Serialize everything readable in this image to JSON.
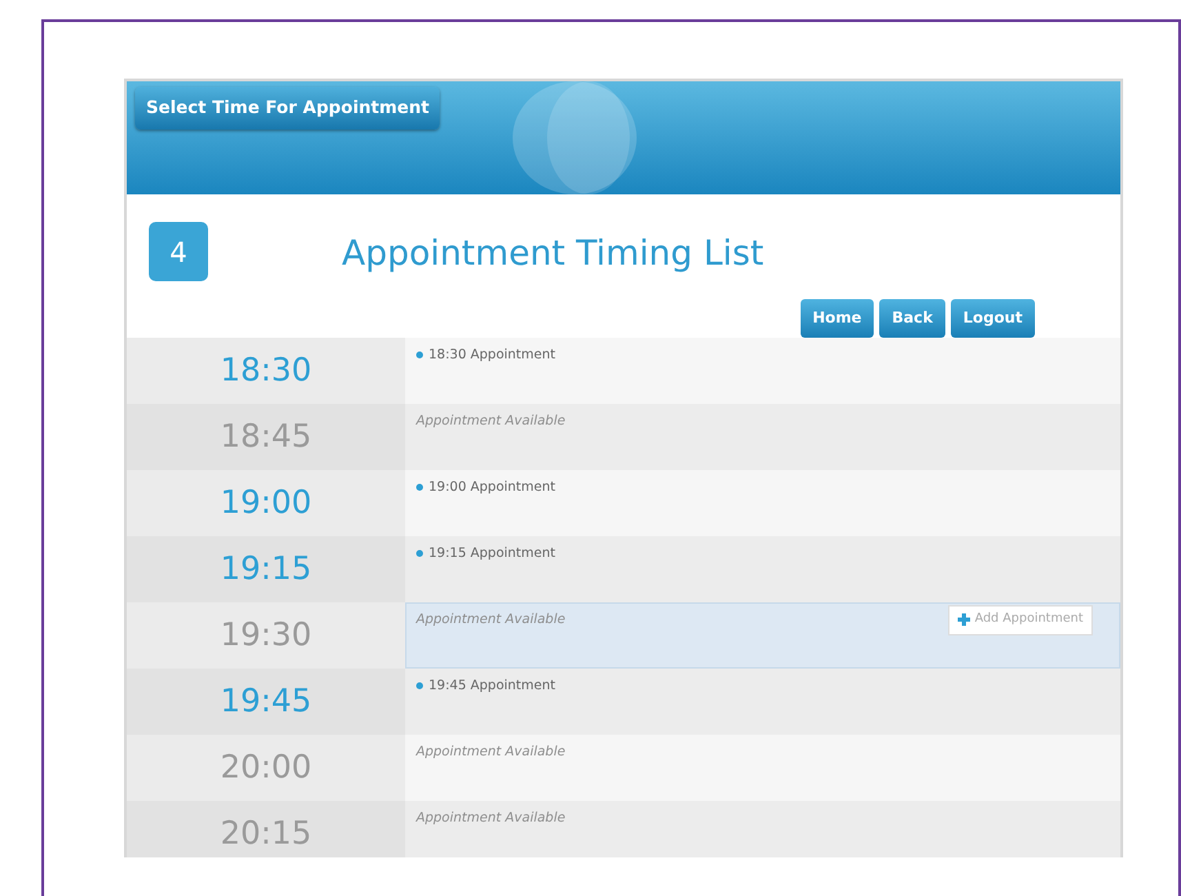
{
  "header": {
    "tab": "Select Time For Appointment"
  },
  "page": {
    "step": "4",
    "title": "Appointment Timing List"
  },
  "buttons": [
    "Home",
    "Back",
    "Logout"
  ],
  "slots": [
    {
      "time": "18:30",
      "kind": "booked",
      "text": "18:30 Appointment",
      "hovered": false
    },
    {
      "time": "18:45",
      "kind": "available",
      "text": "Appointment Available",
      "hovered": false
    },
    {
      "time": "19:00",
      "kind": "booked",
      "text": "19:00 Appointment",
      "hovered": false
    },
    {
      "time": "19:15",
      "kind": "booked",
      "text": "19:15 Appointment",
      "hovered": false
    },
    {
      "time": "19:30",
      "kind": "available",
      "text": "Appointment Available",
      "hovered": true,
      "action": "Add Appointment"
    },
    {
      "time": "19:45",
      "kind": "booked",
      "text": "19:45 Appointment",
      "hovered": false
    },
    {
      "time": "20:00",
      "kind": "available",
      "text": "Appointment Available",
      "hovered": false
    },
    {
      "time": "20:15",
      "kind": "available",
      "text": "Appointment Available",
      "hovered": false
    }
  ]
}
